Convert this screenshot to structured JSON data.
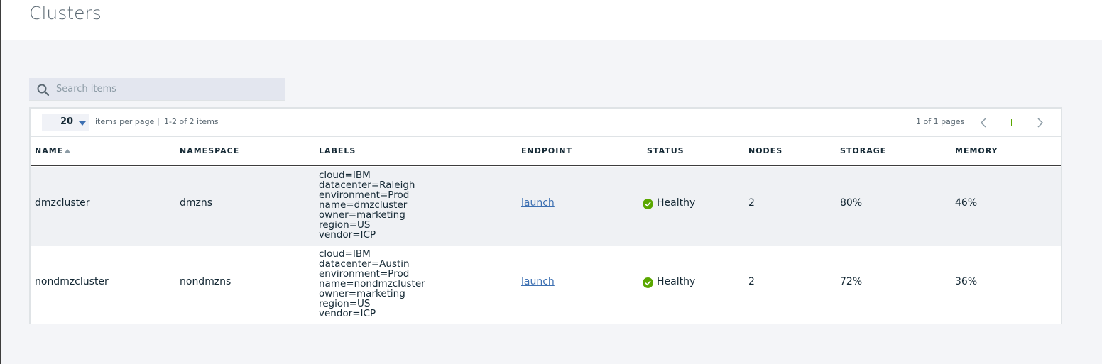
{
  "page": {
    "title": "Clusters"
  },
  "search": {
    "placeholder": "Search items"
  },
  "pagination": {
    "per_page": "20",
    "per_page_label": "items per page",
    "separator": "|",
    "range": "1-2 of 2 items",
    "pages": "1 of 1 pages"
  },
  "columns": [
    "NAME",
    "NAMESPACE",
    "LABELS",
    "ENDPOINT",
    "STATUS",
    "NODES",
    "STORAGE",
    "MEMORY"
  ],
  "rows": [
    {
      "name": "dmzcluster",
      "namespace": "dmzns",
      "labels": [
        "cloud=IBM",
        "datacenter=Raleigh",
        "environment=Prod",
        "name=dmzcluster",
        "owner=marketing",
        "region=US",
        "vendor=ICP"
      ],
      "endpoint": "launch",
      "status": "Healthy",
      "nodes": "2",
      "storage": "80%",
      "memory": "46%"
    },
    {
      "name": "nondmzcluster",
      "namespace": "nondmzns",
      "labels": [
        "cloud=IBM",
        "datacenter=Austin",
        "environment=Prod",
        "name=nondmzcluster",
        "owner=marketing",
        "region=US",
        "vendor=ICP"
      ],
      "endpoint": "launch",
      "status": "Healthy",
      "nodes": "2",
      "storage": "72%",
      "memory": "36%"
    }
  ],
  "colors": {
    "healthy": "#5aa700",
    "link": "#3d70b2",
    "accent_border": "#3d3d3d"
  },
  "icons": {
    "search": "search-icon",
    "caret": "caret-down-icon",
    "prev": "chevron-left-icon",
    "next": "chevron-right-icon",
    "sort": "sort-ascending-icon",
    "status": "checkmark-circle-icon"
  }
}
